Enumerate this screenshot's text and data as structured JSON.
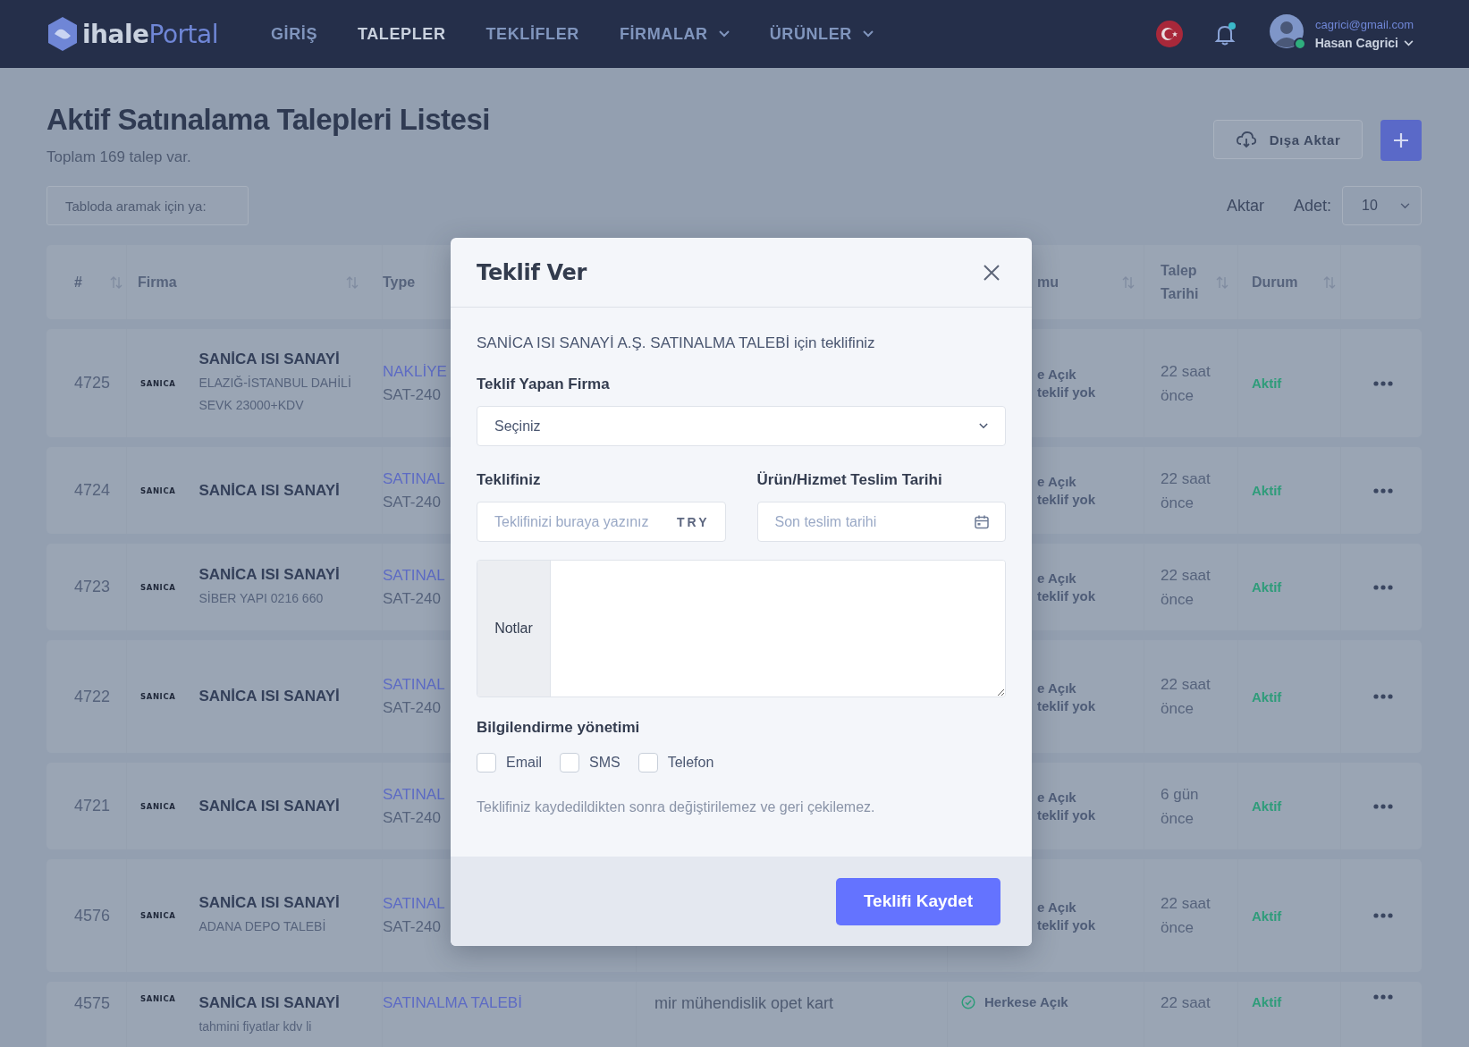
{
  "brand": {
    "part1": "ihale",
    "part2": "Portal"
  },
  "nav": [
    {
      "label": "GİRİŞ",
      "selected": false,
      "dropdown": false
    },
    {
      "label": "TALEPLER",
      "selected": true,
      "dropdown": false
    },
    {
      "label": "TEKLİFLER",
      "selected": false,
      "dropdown": false
    },
    {
      "label": "FİRMALAR",
      "selected": false,
      "dropdown": true
    },
    {
      "label": "ÜRÜNLER",
      "selected": false,
      "dropdown": true
    }
  ],
  "user": {
    "email": "cagrici@gmail.com",
    "name": "Hasan Cagrici",
    "online": true
  },
  "notifications": {
    "unread": true
  },
  "page": {
    "title": "Aktif Satınalama Talepleri Listesi",
    "subtitle": "Toplam 169 talep var.",
    "export_button": "Dışa Aktar",
    "search_placeholder": "Tabloda aramak için ya:",
    "aktar": "Aktar",
    "count_label": "Adet:",
    "count_value": "10"
  },
  "table": {
    "columns": [
      {
        "label": "#",
        "sortable": true
      },
      {
        "label": "Firma",
        "sortable": true
      },
      {
        "label": "Type",
        "sortable": false
      },
      {
        "label": "mu",
        "sortable": true
      },
      {
        "label": "Talep Tarihi",
        "sortable": true
      },
      {
        "label": "Durum",
        "sortable": true
      }
    ],
    "rows": [
      {
        "id": "4725",
        "logo": "SANICA",
        "firma": "SANİCA ISI SANAYİ",
        "note": "ELAZIĞ-İSTANBUL DAHİLİ SEVK 23000+KDV",
        "type": "NAKLİYE",
        "code": "SAT-240",
        "status": [
          "e Açık",
          "teklif yok"
        ],
        "date": "22 saat önce",
        "durum": "Aktif"
      },
      {
        "id": "4724",
        "logo": "SANICA",
        "firma": "SANİCA ISI SANAYİ",
        "type": "SATINAL",
        "code": "SAT-240",
        "status": [
          "e Açık",
          "teklif yok"
        ],
        "date": "22 saat önce",
        "durum": "Aktif"
      },
      {
        "id": "4723",
        "logo": "SANICA",
        "firma": "SANİCA ISI SANAYİ",
        "note": "SİBER YAPI 0216 660",
        "type": "SATINAL",
        "code": "SAT-240",
        "status": [
          "e Açık",
          "teklif yok"
        ],
        "date": "22 saat önce",
        "durum": "Aktif"
      },
      {
        "id": "4722",
        "logo": "SANICA",
        "firma": "SANİCA ISI SANAYİ",
        "type": "SATINAL",
        "code": "SAT-240",
        "status": [
          "e Açık",
          "teklif yok"
        ],
        "date": "22 saat önce",
        "durum": "Aktif"
      },
      {
        "id": "4721",
        "logo": "SANICA",
        "firma": "SANİCA ISI SANAYİ",
        "type": "SATINAL",
        "code": "SAT-240",
        "status": [
          "e Açık",
          "teklif yok"
        ],
        "date": "6 gün önce",
        "durum": "Aktif"
      },
      {
        "id": "4576",
        "logo": "SANICA",
        "firma": "SANİCA ISI SANAYİ",
        "note": "ADANA DEPO TALEBİ",
        "type": "SATINAL",
        "code": "SAT-240",
        "status": [
          "e Açık",
          "teklif yok"
        ],
        "date": "22 saat önce",
        "durum": "Aktif"
      },
      {
        "id": "4575",
        "logo": "SANICA",
        "firma": "SANİCA ISI SANAYİ",
        "note": "tahmini fiyatlar kdv li",
        "type": "SATINALMA TALEBİ",
        "desc": "mir mühendislik opet kart",
        "status_checked": true,
        "status": [
          "Herkese Açık"
        ],
        "date": "22 saat",
        "durum": "Aktif"
      }
    ]
  },
  "modal": {
    "title": "Teklif Ver",
    "intro": "SANİCA ISI SANAYİ A.Ş. SATINALMA TALEBİ için teklifiniz",
    "firm_label": "Teklif Yapan Firma",
    "firm_value": "Seçiniz",
    "offer_label": "Teklifiniz",
    "offer_placeholder": "Teklifinizi buraya yazınız",
    "currency": "TRY",
    "date_label": "Ürün/Hizmet Teslim Tarihi",
    "date_placeholder": "Son teslim tarihi",
    "notes_label": "Notlar",
    "notify_label": "Bilgilendirme yönetimi",
    "channels": [
      {
        "label": "Email",
        "checked": false
      },
      {
        "label": "SMS",
        "checked": false
      },
      {
        "label": "Telefon",
        "checked": false
      }
    ],
    "warning": "Teklifiniz kaydedildikten sonra değiştirilemez ve geri çekilemez.",
    "save_button": "Teklifi Kaydet"
  }
}
